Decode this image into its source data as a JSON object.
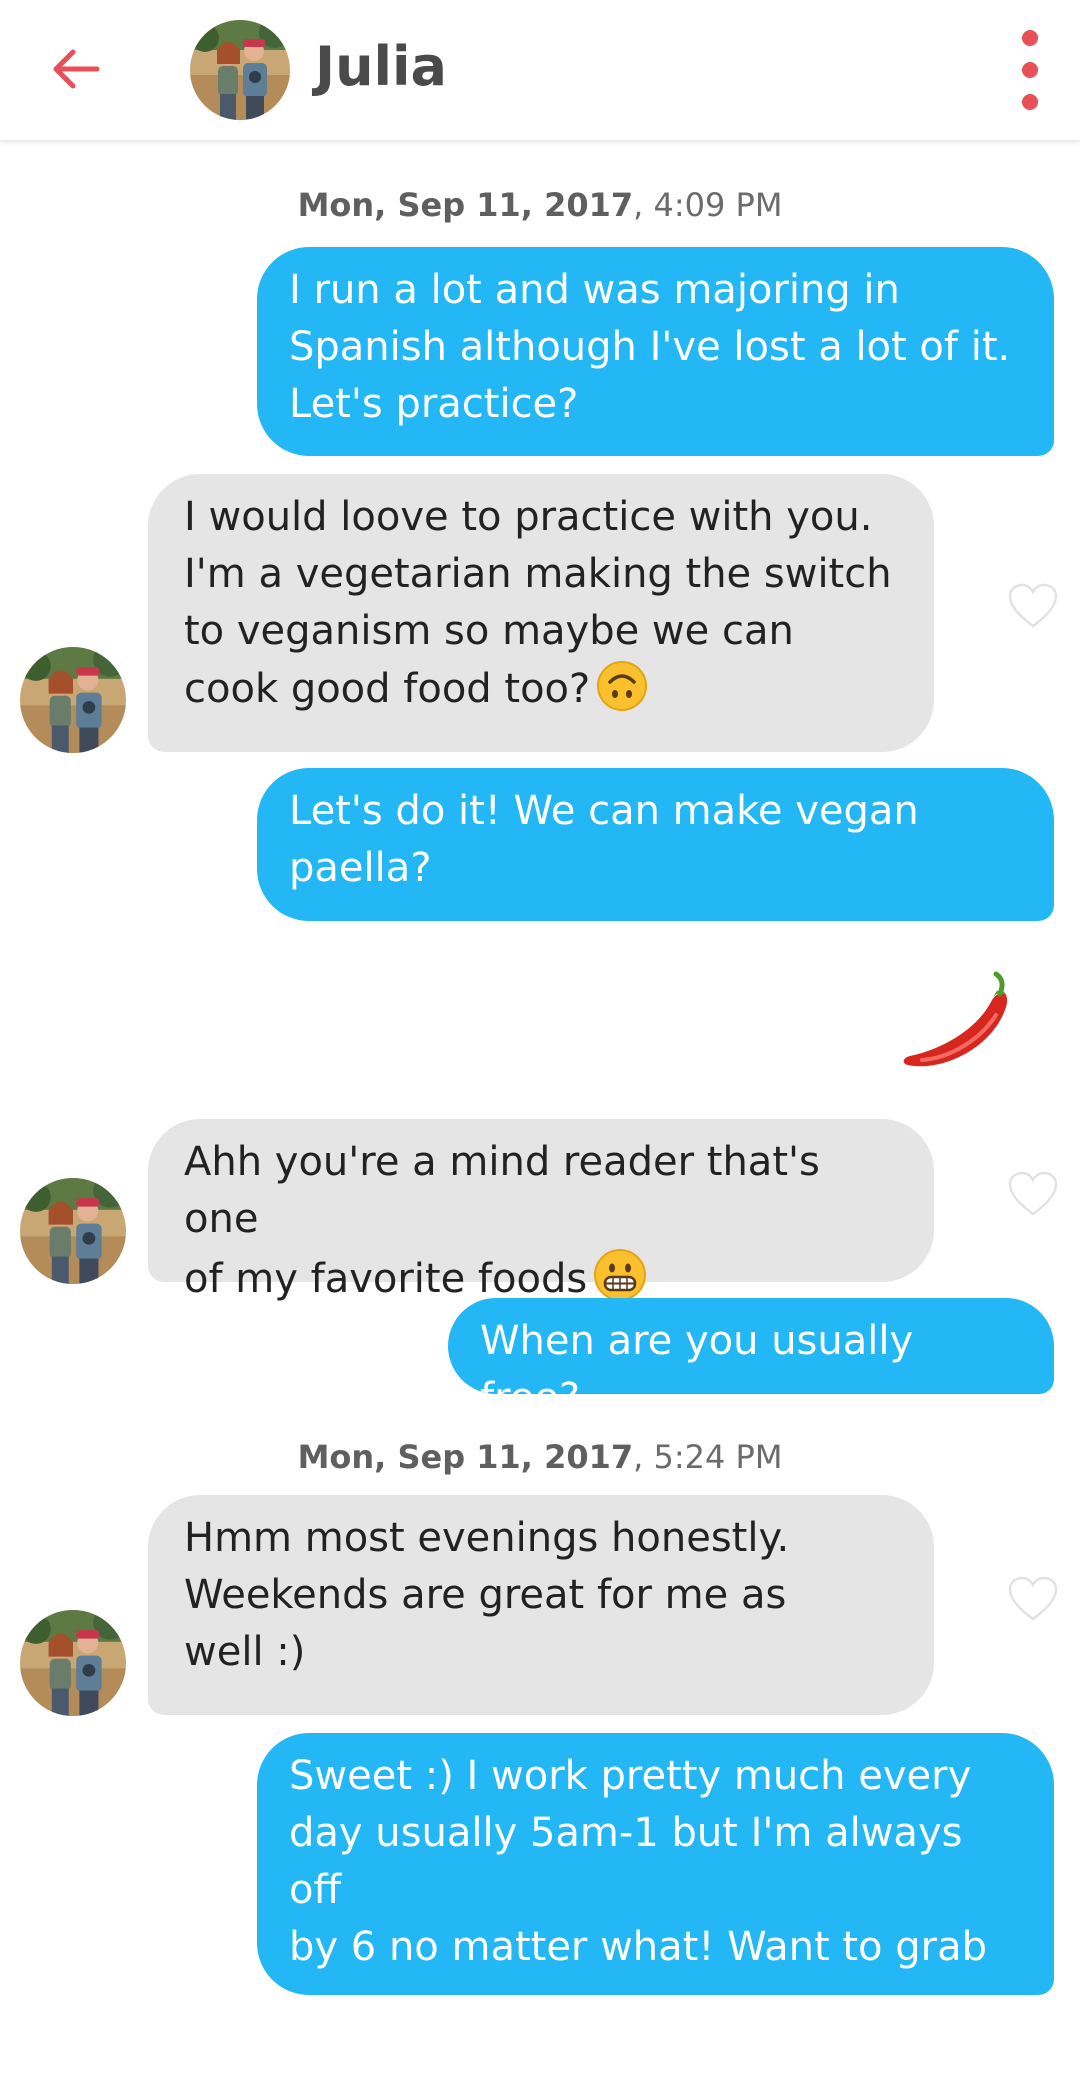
{
  "header": {
    "title": "Julia",
    "back_icon": "arrow-left-icon",
    "menu_icon": "more-vertical-icon",
    "accent_color": "#e94f57"
  },
  "timestamps": [
    {
      "date": "Mon, Sep 11, 2017",
      "time": ", 4:09 PM"
    },
    {
      "date": "Mon, Sep 11, 2017",
      "time": ", 5:24 PM"
    }
  ],
  "messages": [
    {
      "from": "me",
      "text": "I run a lot and was majoring in\nSpanish although I've lost a lot of it.\nLet's practice?"
    },
    {
      "from": "Julia",
      "text": "I would loove to practice with you.\nI'm a vegetarian making the switch\nto veganism so maybe we can\ncook good food too?",
      "emoji": "upside-down-face-emoji"
    },
    {
      "from": "me",
      "text": "Let's do it! We can make vegan\npaella?"
    },
    {
      "from": "me",
      "emoji": "hot-pepper-emoji"
    },
    {
      "from": "Julia",
      "text": "Ahh you're a mind reader that's one\nof my favorite foods",
      "emoji": "grinning-face-emoji"
    },
    {
      "from": "me",
      "text": "When are you usually free?"
    },
    {
      "from": "Julia",
      "text": "Hmm most evenings honestly.\nWeekends are great for me as\nwell :)"
    },
    {
      "from": "me",
      "text": "Sweet :) I work pretty much every\nday usually 5am-1 but I'm always off\nby 6 no matter what! Want to grab a\ndrink or coffee tomorrow?"
    }
  ],
  "colors": {
    "outgoing_bubble": "#23b7f6",
    "incoming_bubble": "#e5e5e5"
  }
}
